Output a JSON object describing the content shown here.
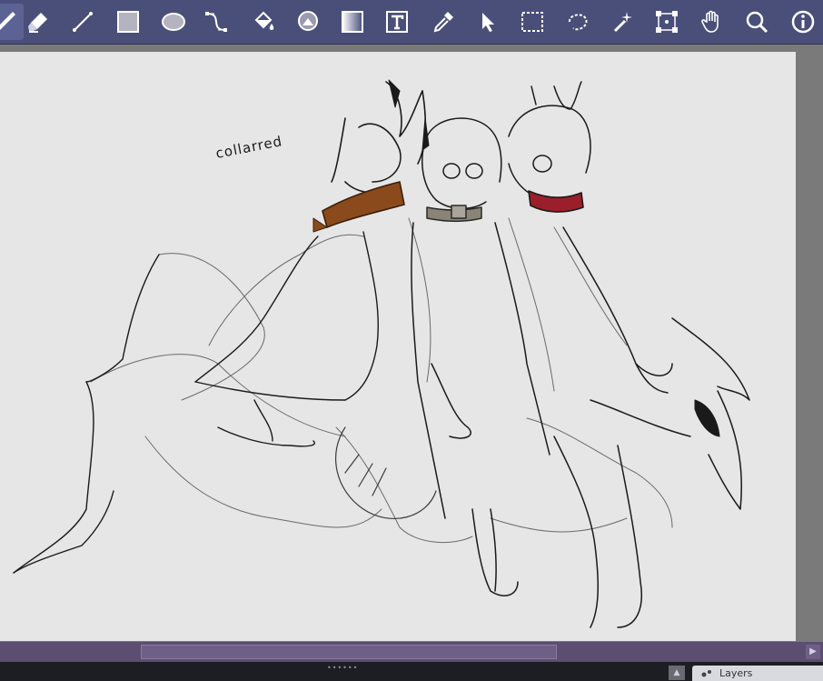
{
  "toolbar": {
    "tools": [
      "brush-icon",
      "eraser-icon",
      "line-icon",
      "rectangle-icon",
      "ellipse-icon",
      "bezier-icon",
      "fill-icon",
      "smart-fill-icon",
      "gradient-icon",
      "text-icon",
      "eyedropper-icon",
      "move-icon",
      "rect-select-icon",
      "freehand-select-icon",
      "magic-wand-icon",
      "transform-icon",
      "pan-icon",
      "zoom-icon",
      "info-icon"
    ]
  },
  "canvas": {
    "annotation": "collarred"
  },
  "panel": {
    "tab_label": "Layers"
  },
  "colors": {
    "toolbar": "#4a4f7a",
    "canvas": "#e6e6e6",
    "scrollbar": "#5c4e70",
    "collar_brown": "#8a4a1c",
    "collar_red": "#9a1f2a"
  }
}
